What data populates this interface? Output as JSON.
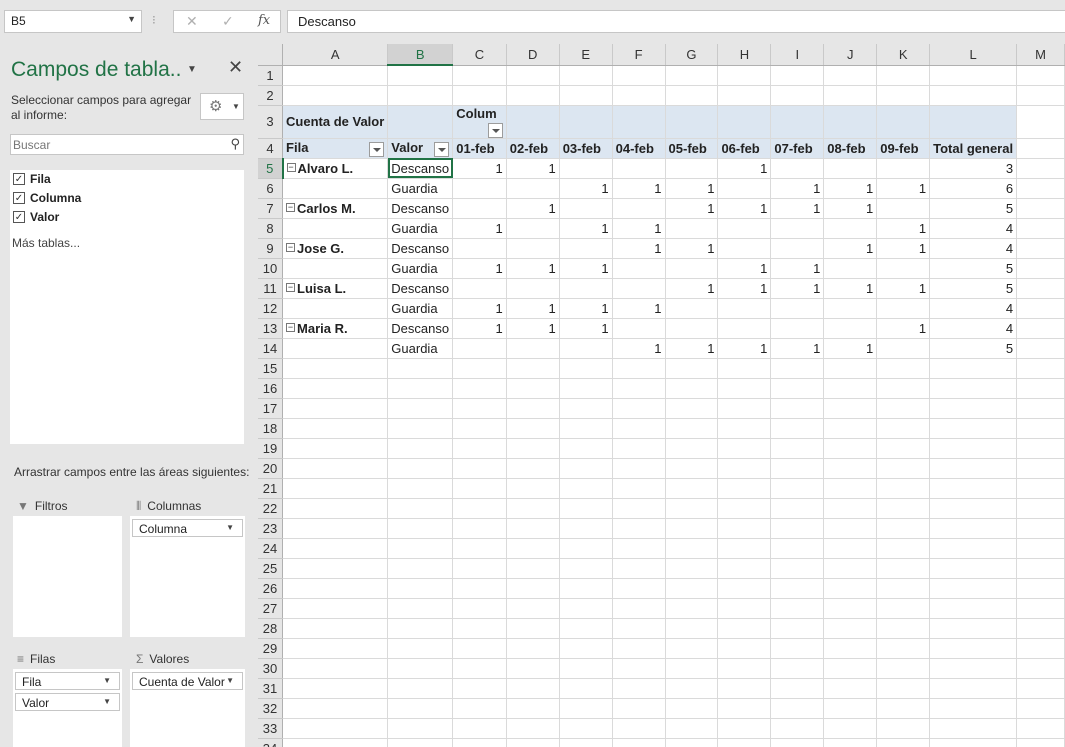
{
  "formula_bar": {
    "name_box": "B5",
    "cancel_icon": "✕",
    "enter_icon": "✓",
    "fx_icon": "fx",
    "value": "Descanso"
  },
  "panel": {
    "title": "Campos de tabla..",
    "instructions": "Seleccionar campos para agregar al informe:",
    "search_placeholder": "Buscar",
    "fields": [
      {
        "label": "Fila",
        "checked": true
      },
      {
        "label": "Columna",
        "checked": true
      },
      {
        "label": "Valor",
        "checked": true
      }
    ],
    "more_tables": "Más tablas...",
    "drag_instructions": "Arrastrar campos entre las áreas siguientes:",
    "areas": {
      "filters": {
        "label": "Filtros"
      },
      "columns": {
        "label": "Columnas",
        "chips": [
          "Columna"
        ]
      },
      "rows": {
        "label": "Filas",
        "chips": [
          "Fila",
          "Valor"
        ]
      },
      "values": {
        "label": "Valores",
        "chips": [
          "Cuenta de Valor"
        ]
      }
    }
  },
  "sheet": {
    "columns": [
      "A",
      "B",
      "C",
      "D",
      "E",
      "F",
      "G",
      "H",
      "I",
      "J",
      "K",
      "L",
      "M"
    ],
    "selected_column": "B",
    "selected_row": 5,
    "row_count": 34,
    "pivot": {
      "value_caption": "Cuenta de Valor",
      "column_caption": "Colum",
      "row_field": "Fila",
      "value_field": "Valor",
      "dates": [
        "01-feb",
        "02-feb",
        "03-feb",
        "04-feb",
        "05-feb",
        "06-feb",
        "07-feb",
        "08-feb",
        "09-feb"
      ],
      "total_label": "Total general",
      "rows": [
        {
          "name": "Alvaro L.",
          "type": "Descanso",
          "vals": [
            "1",
            "1",
            "",
            "",
            "",
            "1",
            "",
            "",
            ""
          ],
          "total": "3"
        },
        {
          "name": "",
          "type": "Guardia",
          "vals": [
            "",
            "",
            "1",
            "1",
            "1",
            "",
            "1",
            "1",
            "1"
          ],
          "total": "6"
        },
        {
          "name": "Carlos M.",
          "type": "Descanso",
          "vals": [
            "",
            "1",
            "",
            "",
            "1",
            "1",
            "1",
            "1",
            ""
          ],
          "total": "5"
        },
        {
          "name": "",
          "type": "Guardia",
          "vals": [
            "1",
            "",
            "1",
            "1",
            "",
            "",
            "",
            "",
            "1"
          ],
          "total": "4"
        },
        {
          "name": "Jose G.",
          "type": "Descanso",
          "vals": [
            "",
            "",
            "",
            "1",
            "1",
            "",
            "",
            "1",
            "1"
          ],
          "total": "4"
        },
        {
          "name": "",
          "type": "Guardia",
          "vals": [
            "1",
            "1",
            "1",
            "",
            "",
            "1",
            "1",
            "",
            ""
          ],
          "total": "5"
        },
        {
          "name": "Luisa L.",
          "type": "Descanso",
          "vals": [
            "",
            "",
            "",
            "",
            "1",
            "1",
            "1",
            "1",
            "1"
          ],
          "total": "5"
        },
        {
          "name": "",
          "type": "Guardia",
          "vals": [
            "1",
            "1",
            "1",
            "1",
            "",
            "",
            "",
            "",
            ""
          ],
          "total": "4"
        },
        {
          "name": "Maria R.",
          "type": "Descanso",
          "vals": [
            "1",
            "1",
            "1",
            "",
            "",
            "",
            "",
            "",
            "1"
          ],
          "total": "4"
        },
        {
          "name": "",
          "type": "Guardia",
          "vals": [
            "",
            "",
            "",
            "1",
            "1",
            "1",
            "1",
            "1",
            ""
          ],
          "total": "5"
        }
      ]
    }
  }
}
